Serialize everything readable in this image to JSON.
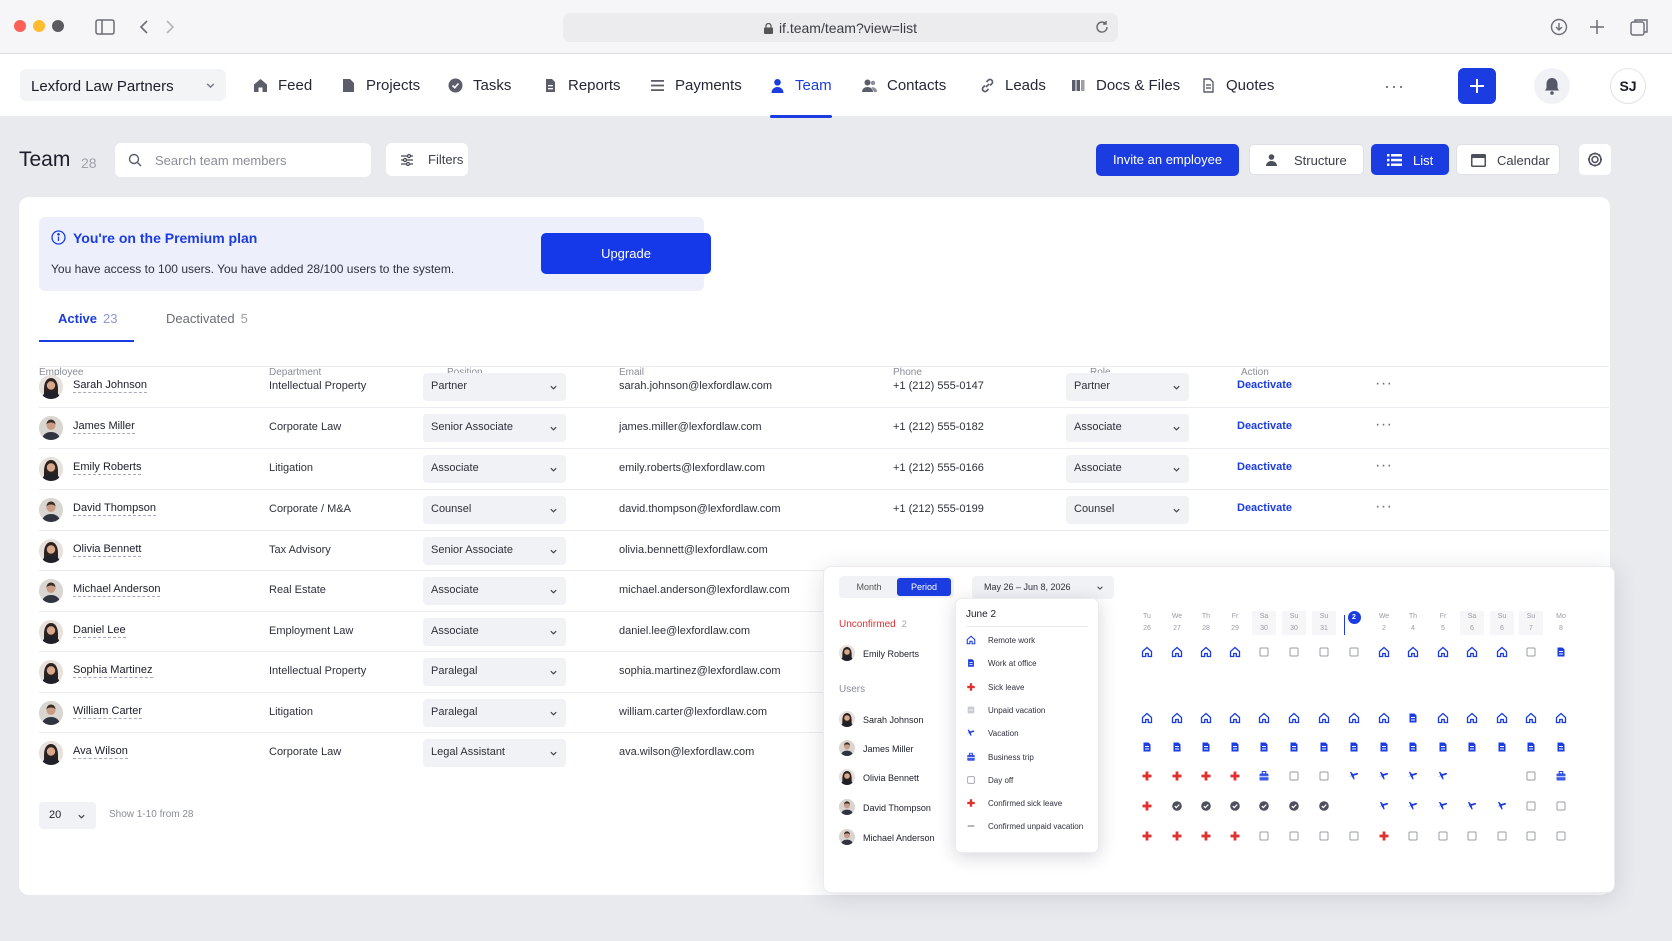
{
  "browser": {
    "url": "if.team/team?view=list"
  },
  "header": {
    "company": "Lexford Law Partners",
    "nav": [
      {
        "label": "Feed",
        "icon": "home-icon"
      },
      {
        "label": "Projects",
        "icon": "folder-icon"
      },
      {
        "label": "Tasks",
        "icon": "check-circle-icon"
      },
      {
        "label": "Reports",
        "icon": "report-icon"
      },
      {
        "label": "Payments",
        "icon": "list-icon"
      },
      {
        "label": "Team",
        "icon": "user-icon",
        "active": true
      },
      {
        "label": "Contacts",
        "icon": "contacts-icon"
      },
      {
        "label": "Leads",
        "icon": "link-icon"
      },
      {
        "label": "Docs & Files",
        "icon": "docs-icon"
      },
      {
        "label": "Quotes",
        "icon": "quote-doc-icon"
      }
    ],
    "more": "···",
    "user_initials": "SJ"
  },
  "page": {
    "title": "Team",
    "count": "28",
    "search_placeholder": "Search team members",
    "filters_label": "Filters",
    "invite_label": "Invite an employee",
    "views": {
      "structure": "Structure",
      "list": "List",
      "calendar": "Calendar"
    },
    "active_view": "List"
  },
  "banner": {
    "title": "You're on the Premium plan",
    "description": "You have access to 100 users. You have added 28/100 users to the system.",
    "upgrade_label": "Upgrade"
  },
  "tabs": [
    {
      "label": "Active",
      "count": "23",
      "active": true
    },
    {
      "label": "Deactivated",
      "count": "5",
      "active": false
    }
  ],
  "table": {
    "columns": [
      "Employee",
      "Department",
      "Position",
      "Email",
      "Phone",
      "Role",
      "Action"
    ],
    "rows": [
      {
        "name": "Sarah Johnson",
        "department": "Intellectual Property",
        "position": "Partner",
        "email": "sarah.johnson@lexfordlaw.com",
        "phone": "+1 (212) 555-0147",
        "role": "Partner",
        "action": "Deactivate",
        "avatar": "f"
      },
      {
        "name": "James Miller",
        "department": "Corporate Law",
        "position": "Senior Associate",
        "email": "james.miller@lexfordlaw.com",
        "phone": "+1 (212) 555-0182",
        "role": "Associate",
        "action": "Deactivate",
        "avatar": "m"
      },
      {
        "name": "Emily Roberts",
        "department": "Litigation",
        "position": "Associate",
        "email": "emily.roberts@lexfordlaw.com",
        "phone": "+1 (212) 555-0166",
        "role": "Associate",
        "action": "Deactivate",
        "avatar": "f"
      },
      {
        "name": "David Thompson",
        "department": "Corporate / M&A",
        "position": "Counsel",
        "email": "david.thompson@lexfordlaw.com",
        "phone": "+1 (212) 555-0199",
        "role": "Counsel",
        "action": "Deactivate",
        "avatar": "m"
      },
      {
        "name": "Olivia Bennett",
        "department": "Tax Advisory",
        "position": "Senior Associate",
        "email": "olivia.bennett@lexfordlaw.com",
        "phone": "",
        "role": "",
        "action": "",
        "avatar": "f"
      },
      {
        "name": "Michael Anderson",
        "department": "Real Estate",
        "position": "Associate",
        "email": "michael.anderson@lexfordlaw.com",
        "phone": "",
        "role": "",
        "action": "",
        "avatar": "m"
      },
      {
        "name": "Daniel Lee",
        "department": "Employment Law",
        "position": "Associate",
        "email": "daniel.lee@lexfordlaw.com",
        "phone": "",
        "role": "",
        "action": "",
        "avatar": "f"
      },
      {
        "name": "Sophia Martinez",
        "department": "Intellectual Property",
        "position": "Paralegal",
        "email": "sophia.martinez@lexfordlaw.com",
        "phone": "",
        "role": "",
        "action": "",
        "avatar": "f"
      },
      {
        "name": "William Carter",
        "department": "Litigation",
        "position": "Paralegal",
        "email": "william.carter@lexfordlaw.com",
        "phone": "",
        "role": "",
        "action": "",
        "avatar": "m"
      },
      {
        "name": "Ava Wilson",
        "department": "Corporate Law",
        "position": "Legal Assistant",
        "email": "ava.wilson@lexfordlaw.com",
        "phone": "",
        "role": "",
        "action": "",
        "avatar": "f"
      }
    ],
    "page_size": "20",
    "page_info": "Show 1-10 from 28"
  },
  "calendar": {
    "modes": [
      "Month",
      "Period"
    ],
    "active_mode": "Period",
    "date_range": "May 26 – Jun 8, 2026",
    "unconfirmed_label": "Unconfirmed",
    "unconfirmed_count": "2",
    "users_label": "Users",
    "days": [
      {
        "dow": "Tu",
        "num": "26"
      },
      {
        "dow": "We",
        "num": "27"
      },
      {
        "dow": "Th",
        "num": "28"
      },
      {
        "dow": "Fr",
        "num": "29"
      },
      {
        "dow": "Sa",
        "num": "30"
      },
      {
        "dow": "Su",
        "num": "30"
      },
      {
        "dow": "Su",
        "num": "31"
      },
      {
        "dow": "",
        "num": "2",
        "today": true
      },
      {
        "dow": "We",
        "num": "2"
      },
      {
        "dow": "Th",
        "num": "4"
      },
      {
        "dow": "Fr",
        "num": "5"
      },
      {
        "dow": "Sa",
        "num": "6"
      },
      {
        "dow": "Su",
        "num": "6"
      },
      {
        "dow": "Su",
        "num": "7"
      },
      {
        "dow": "Mo",
        "num": "8"
      }
    ],
    "unconfirmed_users": [
      {
        "name": "Emily Roberts",
        "cells": [
          "remote",
          "remote",
          "remote",
          "remote",
          "off",
          "off",
          "off",
          "off",
          "remote",
          "remote",
          "remote",
          "remote",
          "remote",
          "off",
          "office"
        ]
      }
    ],
    "users": [
      {
        "name": "Sarah Johnson",
        "cells": [
          "remote",
          "remote",
          "remote",
          "remote",
          "remote",
          "remote",
          "remote",
          "remote",
          "remote",
          "office",
          "remote",
          "remote",
          "remote",
          "remote",
          "remote"
        ]
      },
      {
        "name": "James Miller",
        "cells": [
          "office",
          "office",
          "office",
          "office",
          "office",
          "office",
          "office",
          "office",
          "office",
          "office",
          "office",
          "office",
          "office",
          "office",
          "office"
        ]
      },
      {
        "name": "Olivia Bennett",
        "cells": [
          "sick",
          "sick",
          "sick",
          "sick",
          "trip",
          "off",
          "off",
          "vacation",
          "vacation",
          "vacation",
          "vacation",
          "",
          "",
          "off",
          "trip"
        ]
      },
      {
        "name": "David Thompson",
        "cells": [
          "sick",
          "check",
          "check",
          "check",
          "check",
          "check",
          "check",
          "",
          "vacation",
          "vacation",
          "vacation",
          "vacation",
          "vacation",
          "off",
          "off"
        ]
      },
      {
        "name": "Michael Anderson",
        "cells": [
          "sick",
          "sick",
          "sick",
          "sick",
          "off",
          "off",
          "off",
          "off",
          "sick",
          "off",
          "off",
          "off",
          "off",
          "off",
          "off"
        ]
      }
    ],
    "legend_title": "June 2",
    "legend": [
      {
        "type": "remote",
        "label": "Remote work"
      },
      {
        "type": "office",
        "label": "Work at office"
      },
      {
        "type": "sick",
        "label": "Sick leave"
      },
      {
        "type": "unpaid",
        "label": "Unpaid vacation"
      },
      {
        "type": "vacation",
        "label": "Vacation"
      },
      {
        "type": "trip",
        "label": "Business trip"
      },
      {
        "type": "off",
        "label": "Day off"
      },
      {
        "type": "csick",
        "label": "Confirmed sick leave"
      },
      {
        "type": "cunpaid",
        "label": "Confirmed unpaid vacation"
      }
    ]
  }
}
